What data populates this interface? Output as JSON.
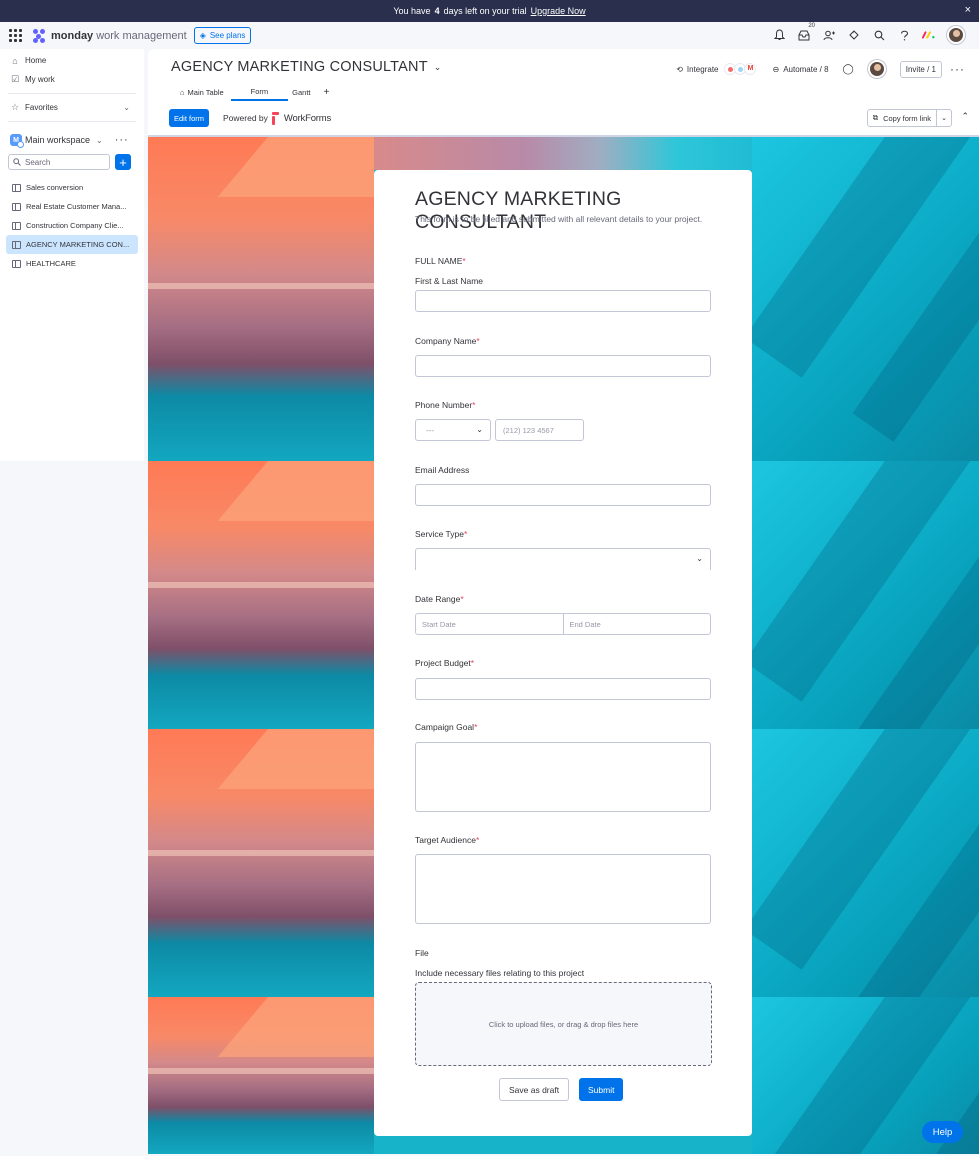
{
  "trial": {
    "text_before": "You have",
    "days": "4",
    "text_after": "days left on your trial",
    "upgrade": "Upgrade Now",
    "close": "×"
  },
  "topnav": {
    "brand": "monday",
    "product": "work management",
    "see_plans": "See plans",
    "inbox_badge": "20"
  },
  "sidebar": {
    "home": "Home",
    "my_work": "My work",
    "favorites": "Favorites",
    "workspace_initial": "M",
    "workspace": "Main workspace",
    "search_placeholder": "Search",
    "boards": [
      {
        "label": "Sales conversion"
      },
      {
        "label": "Real Estate Customer Mana..."
      },
      {
        "label": "Construction Company Clie..."
      },
      {
        "label": "AGENCY MARKETING CON..."
      },
      {
        "label": "HEALTHCARE"
      }
    ]
  },
  "board": {
    "title": "AGENCY MARKETING CONSULTANT",
    "integrate": "Integrate",
    "automate": "Automate / 8",
    "invite": "Invite / 1",
    "tabs": [
      {
        "label": "Main Table"
      },
      {
        "label": "Form"
      },
      {
        "label": "Gantt"
      }
    ],
    "edit_form": "Edit form",
    "powered_by": "Powered by",
    "workforms": "WorkForms",
    "copy_form_link": "Copy form link"
  },
  "form": {
    "title": "AGENCY MARKETING CONSULTANT",
    "description": "This form is to be filled and submitted with all relevant details to your project.",
    "full_name_heading": "FULL NAME",
    "first_last": "First & Last Name",
    "company": "Company Name",
    "phone": "Phone Number",
    "country_placeholder": "---",
    "phone_placeholder": "(212) 123 4567",
    "email": "Email Address",
    "service": "Service Type",
    "date_range": "Date Range",
    "start_date": "Start Date",
    "end_date": "End Date",
    "budget": "Project Budget",
    "goal": "Campaign Goal",
    "audience": "Target Audience",
    "file": "File",
    "file_hint": "Include necessary files relating to this project",
    "dropzone": "Click to upload files, or drag & drop files here",
    "save_draft": "Save as draft",
    "submit": "Submit",
    "required_mark": "*"
  },
  "help": "Help",
  "colors": {
    "primary": "#0073ea",
    "dark_bar": "#292f4c",
    "required": "#e2445c",
    "selected_row": "#cce5ff"
  }
}
